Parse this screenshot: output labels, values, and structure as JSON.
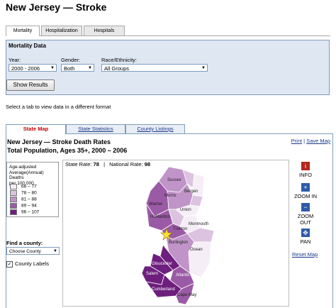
{
  "page_title": "New Jersey — Stroke",
  "top_tabs": [
    "Mortality",
    "Hospitalization",
    "Hospitals"
  ],
  "panel": {
    "title": "Mortality Data",
    "year_label": "Year:",
    "year_value": "2000 - 2006",
    "gender_label": "Gender:",
    "gender_value": "Both",
    "race_label": "Race/Ethnicity:",
    "race_value": "All Groups",
    "show_button": "Show Results"
  },
  "hint": "Select a tab to view data in a different format",
  "map_tabs": [
    "State Map",
    "State Statistics",
    "County Listings"
  ],
  "map": {
    "title_line1": "New Jersey — Stroke Death Rates",
    "title_line2": "Total Population, Ages 35+, 2000 – 2006",
    "print_label": "Print",
    "separator": "|",
    "save_label": "Save Map",
    "state_rate_label": "State Rate:",
    "state_rate": "78",
    "national_rate_label": "National Rate:",
    "national_rate": "98",
    "rate_separator": "|"
  },
  "legend": {
    "title_lines": [
      "Age-adjusted",
      "Average(Annual) Deaths",
      "per 100,000"
    ],
    "items": [
      {
        "range": "66 – 77",
        "color": "#f6eef7"
      },
      {
        "range": "78 – 80",
        "color": "#dcc3e0"
      },
      {
        "range": "81 – 88",
        "color": "#c094c8"
      },
      {
        "range": "89 – 94",
        "color": "#9b5aa6"
      },
      {
        "range": "96 – 107",
        "color": "#6e1f7d"
      }
    ]
  },
  "find_county": {
    "label": "Find a county:",
    "select_value": "Choose County",
    "checkbox_label": "County Labels",
    "checkbox_checked": true
  },
  "controls": {
    "info_label": "INFO",
    "zoom_in_label": "ZOOM IN",
    "zoom_out_label": "ZOOM OUT",
    "pan_label": "PAN",
    "reset_label": "Reset Map",
    "info_icon_glyph": "i",
    "zoom_in_glyph": "+",
    "zoom_out_glyph": "−",
    "pan_glyph": "✥"
  },
  "counties": {
    "sussex": "Sussex",
    "bergen": "Bergen",
    "morris": "Morris",
    "warren": "Warren",
    "hunterdon": "Hunterdon",
    "union": "Union",
    "monmouth": "Monmouth",
    "trenton": "Trenton",
    "ocean": "Ocean",
    "burlington": "Burlington",
    "gloucester": "Gloucester",
    "salem": "Salem",
    "atlantic": "Atlantic",
    "cumberland": "Cumberland",
    "cape_may": "Cape May"
  },
  "colors": {
    "tab_active": "#c00000",
    "link": "#1a3a8a",
    "panel_bg": "#dfe7f3",
    "info_red": "#b3261e",
    "control_blue": "#2f5aa8"
  }
}
